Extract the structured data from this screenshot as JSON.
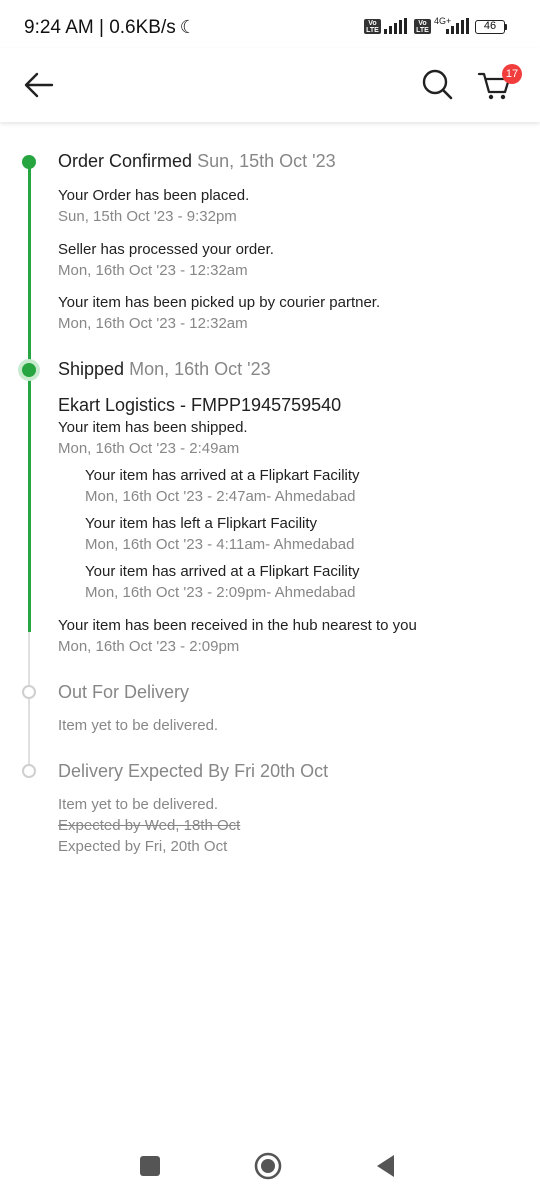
{
  "status_bar": {
    "time_speed": "9:24 AM | 0.6KB/s",
    "volte_label": "Vo LTE",
    "network_label": "4G+",
    "battery_level": "46"
  },
  "header": {
    "cart_count": "17"
  },
  "timeline": {
    "order_confirmed": {
      "title": "Order Confirmed",
      "date": "Sun, 15th Oct '23",
      "events": [
        {
          "text": "Your Order has been placed.",
          "time": "Sun, 15th Oct '23 - 9:32pm"
        },
        {
          "text": "Seller has processed your order.",
          "time": "Mon, 16th Oct '23 - 12:32am"
        },
        {
          "text": "Your item has been picked up by courier partner.",
          "time": "Mon, 16th Oct '23 - 12:32am"
        }
      ]
    },
    "shipped": {
      "title": "Shipped",
      "date": "Mon, 16th Oct '23",
      "courier": "Ekart Logistics - FMPP1945759540",
      "shipped_event": {
        "text": "Your item has been shipped.",
        "time": "Mon, 16th Oct '23 - 2:49am"
      },
      "facility_events": [
        {
          "text": "Your item has arrived at a Flipkart Facility",
          "time": "Mon, 16th Oct '23 - 2:47am- Ahmedabad"
        },
        {
          "text": "Your item has left a Flipkart Facility",
          "time": "Mon, 16th Oct '23 - 4:11am- Ahmedabad"
        },
        {
          "text": "Your item has arrived at a Flipkart Facility",
          "time": "Mon, 16th Oct '23 - 2:09pm- Ahmedabad"
        }
      ],
      "hub_event": {
        "text": "Your item has been received in the hub nearest to you",
        "time": "Mon, 16th Oct '23 - 2:09pm"
      }
    },
    "out_for_delivery": {
      "title": "Out For Delivery",
      "note": "Item yet to be delivered."
    },
    "delivery_expected": {
      "title": "Delivery Expected By Fri 20th Oct",
      "note": "Item yet to be delivered.",
      "old_expected": "Expected by Wed, 18th Oct",
      "new_expected": "Expected by Fri, 20th Oct"
    }
  },
  "colors": {
    "success_green": "#26a541",
    "muted_text": "#878787",
    "badge_red": "#f23d3d"
  }
}
